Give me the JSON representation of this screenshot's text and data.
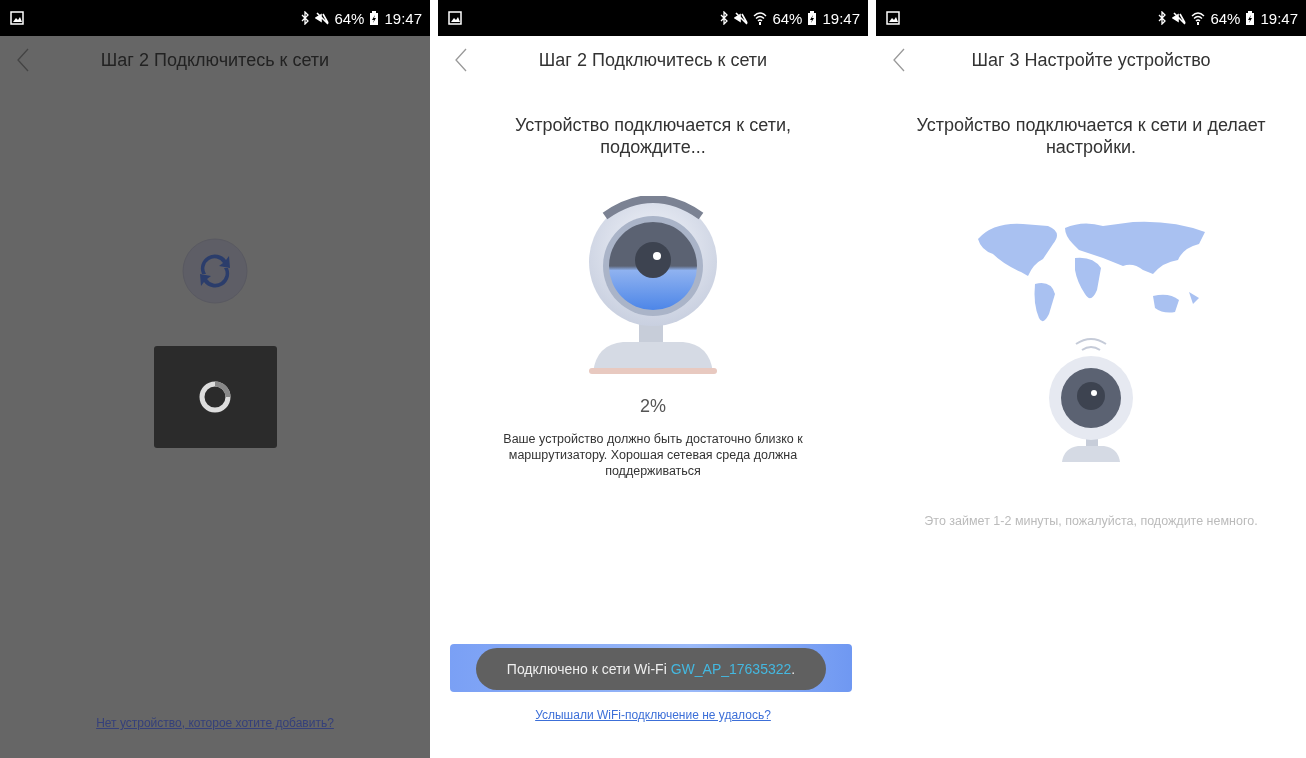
{
  "screens": [
    {
      "dimmed": true,
      "status_bar": {
        "wifi": false,
        "battery": "64%",
        "time": "19:47"
      },
      "header": {
        "title": "Шаг 2 Подключитесь к сети"
      },
      "kind": "refresh",
      "loading_dialog": true,
      "link": "Нет устройство, которое хотите добавить?"
    },
    {
      "dimmed": false,
      "status_bar": {
        "wifi": true,
        "battery": "64%",
        "time": "19:47"
      },
      "header": {
        "title": "Шаг 2 Подключитесь к сети"
      },
      "message": "Устройство подключается к сети, подождите...",
      "kind": "webcam",
      "percent": "2%",
      "note": "Ваше устройство должно быть достаточно близко к маршрутизатору. Хорошая сетевая среда должна поддерживаться",
      "button": true,
      "toast": {
        "text": "Подключено к сети Wi-Fi ",
        "network": "GW_AP_17635322",
        "end": "."
      },
      "link": "Услышали WiFi-подключение не удалось?"
    },
    {
      "dimmed": false,
      "status_bar": {
        "wifi": true,
        "battery": "64%",
        "time": "19:47"
      },
      "header": {
        "title": "Шаг 3 Настройте устройство"
      },
      "message": "Устройство подключается к сети и делает настройки.",
      "kind": "map-webcam",
      "hint": "Это займет 1-2 минуты, пожалуйста, подождите немного."
    }
  ]
}
